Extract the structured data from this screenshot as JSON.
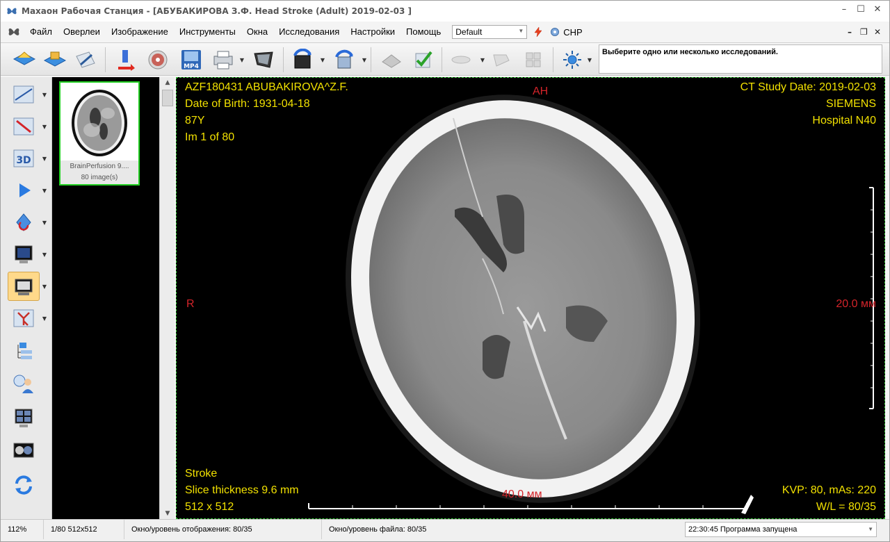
{
  "window": {
    "title": "Махаон Рабочая Станция - [АБУБАКИРОВА З.Ф. Head Stroke (Adult) 2019-02-03 ]",
    "controls": {
      "minimize": "–",
      "maximize": "☐",
      "close": "✕"
    }
  },
  "menu": {
    "items": [
      "Файл",
      "Оверлеи",
      "Изображение",
      "Инструменты",
      "Окна",
      "Исследования",
      "Настройки",
      "Помощь"
    ],
    "preset": "Default",
    "language": "CHP",
    "mdi_controls": {
      "minimize": "–",
      "restore": "❐",
      "close": "✕"
    }
  },
  "toolbar": {
    "message": "Выберите одно или несколько исследований.",
    "mp4_label": "MP4"
  },
  "thumbnail": {
    "series": "BrainPerfusion  9....",
    "count": "80 image(s)"
  },
  "viewer": {
    "patient": "AZF180431 ABUBAKIROVA^Z.F.",
    "dob": "Date of Birth: 1931-04-18",
    "age": "87Y",
    "image_index": "Im 1 of 80",
    "study_date": "CT Study Date: 2019-02-03",
    "manufacturer": "SIEMENS",
    "institution": "Hospital N40",
    "orient_top": "AH",
    "orient_left": "R",
    "scale_right": "20.0 мм",
    "scale_bottom": "40.0 мм",
    "description": "Stroke",
    "slice_thickness": "Slice thickness 9.6 mm",
    "matrix": "512 x 512",
    "kvp": "KVP: 80, mAs: 220",
    "wl": "W/L = 80/35"
  },
  "status": {
    "zoom": "112%",
    "frame": "1/80 512x512",
    "display_wl": "Окно/уровень отображения: 80/35",
    "file_wl": "Окно/уровень файла: 80/35",
    "log": "22:30:45 Программа запущена"
  },
  "colors": {
    "overlay_text": "#f2e100",
    "orientation_text": "#d4242a",
    "selection_border": "#22d022",
    "active_tool": "#ffd98a"
  }
}
